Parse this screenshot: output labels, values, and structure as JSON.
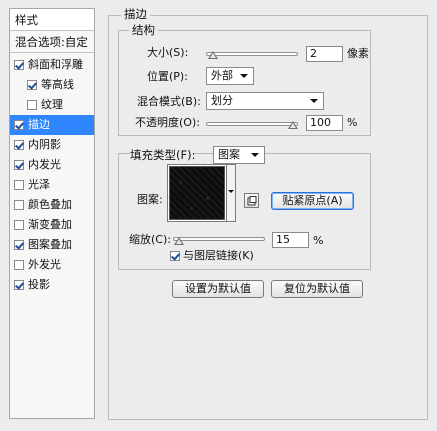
{
  "sidebar": {
    "header": "样式",
    "blend_options": "混合选项:自定",
    "items": [
      {
        "label": "斜面和浮雕",
        "checked": true,
        "indent": false,
        "selected": false
      },
      {
        "label": "等高线",
        "checked": true,
        "indent": true,
        "selected": false
      },
      {
        "label": "纹理",
        "checked": false,
        "indent": true,
        "selected": false
      },
      {
        "label": "描边",
        "checked": true,
        "indent": false,
        "selected": true
      },
      {
        "label": "内阴影",
        "checked": true,
        "indent": false,
        "selected": false
      },
      {
        "label": "内发光",
        "checked": true,
        "indent": false,
        "selected": false
      },
      {
        "label": "光泽",
        "checked": false,
        "indent": false,
        "selected": false
      },
      {
        "label": "颜色叠加",
        "checked": false,
        "indent": false,
        "selected": false
      },
      {
        "label": "渐变叠加",
        "checked": false,
        "indent": false,
        "selected": false
      },
      {
        "label": "图案叠加",
        "checked": true,
        "indent": false,
        "selected": false
      },
      {
        "label": "外发光",
        "checked": false,
        "indent": false,
        "selected": false
      },
      {
        "label": "投影",
        "checked": true,
        "indent": false,
        "selected": false
      }
    ]
  },
  "stroke": {
    "title": "描边",
    "structure": {
      "title": "结构",
      "size_label": "大小(S):",
      "size_value": "2",
      "size_unit": "像素",
      "position_label": "位置(P):",
      "position_value": "外部",
      "blend_mode_label": "混合模式(B):",
      "blend_mode_value": "划分",
      "opacity_label": "不透明度(O):",
      "opacity_value": "100",
      "opacity_unit": "%"
    },
    "fill": {
      "fill_type_label": "填充类型(F):",
      "fill_type_value": "图案",
      "pattern_label": "图案:",
      "snap_origin_label": "贴紧原点(A)",
      "scale_label": "缩放(C):",
      "scale_value": "15",
      "scale_unit": "%",
      "link_with_layer_label": "与图层链接(K)",
      "link_with_layer_checked": true
    },
    "buttons": {
      "make_default": "设置为默认值",
      "reset_default": "复位为默认值"
    }
  },
  "sliders": {
    "size_fraction": 0.02,
    "opacity_fraction": 1.0,
    "scale_fraction": 0.015
  },
  "colors": {
    "selected_bg": "#2f86ff",
    "panel_bg": "#ececec"
  }
}
